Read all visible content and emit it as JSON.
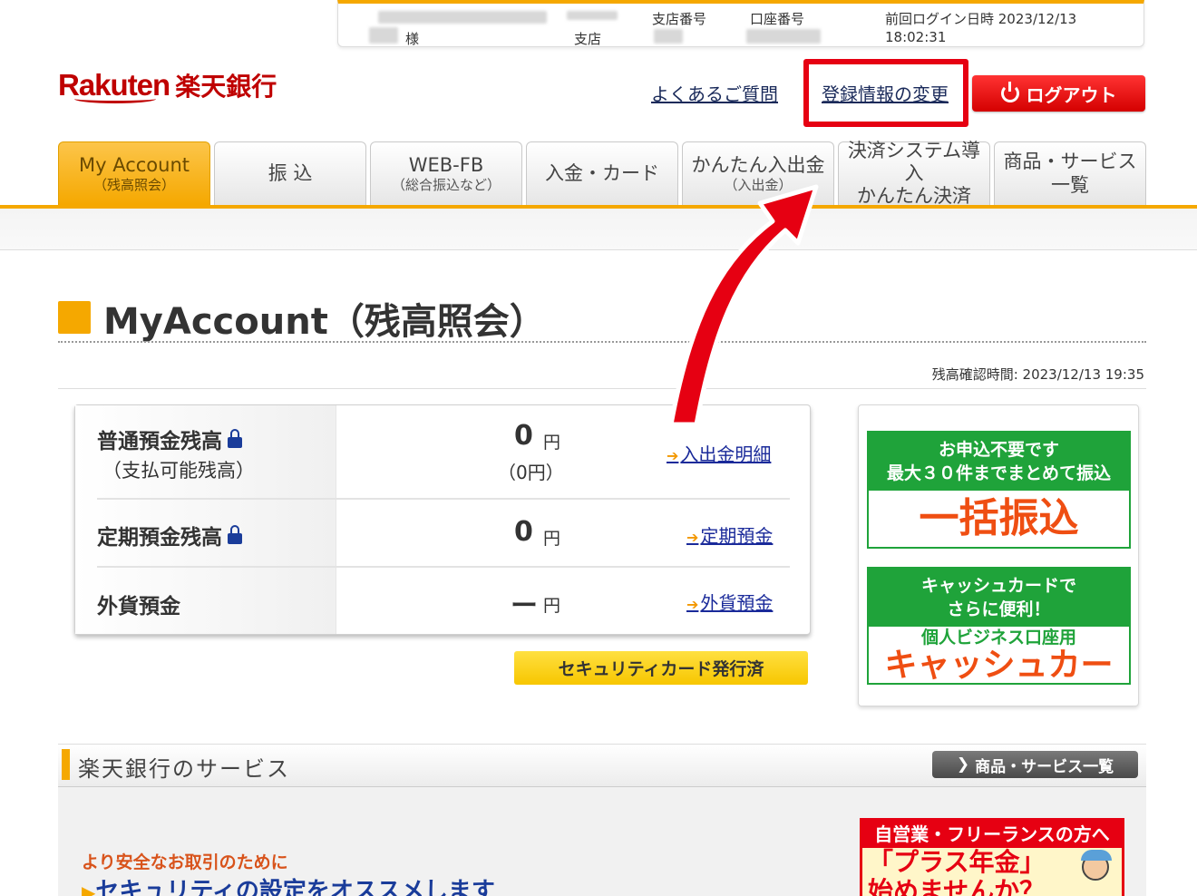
{
  "infobar": {
    "honorific": "様",
    "branch_suffix": "支店",
    "branch_no_label": "支店番号",
    "account_no_label": "口座番号",
    "last_login_label": "前回ログイン日時 2023/12/13",
    "last_login_time": "18:02:31"
  },
  "header": {
    "logo_en": "Rakuten",
    "logo_jp": "楽天銀行",
    "faq_link": "よくあるご質問",
    "profile_link": "登録情報の変更",
    "logout_label": "ログアウト"
  },
  "tabs": [
    {
      "label": "My Account",
      "sub": "（残高照会）"
    },
    {
      "label": "振 込",
      "sub": ""
    },
    {
      "label": "WEB-FB",
      "sub": "（総合振込など）"
    },
    {
      "label": "入金・カード",
      "sub": ""
    },
    {
      "label": "かんたん入出金",
      "sub": "（入出金）"
    },
    {
      "label": "決済システム導入",
      "sub": "かんたん決済"
    },
    {
      "label": "商品・サービス",
      "sub": "一覧"
    }
  ],
  "page": {
    "title": "MyAccount（残高照会）",
    "confirm_time": "残高確認時間: 2023/12/13 19:35"
  },
  "balances": {
    "ordinary": {
      "label": "普通預金残高",
      "sub": "（支払可能残高）",
      "amount": "0",
      "unit": "円",
      "amount_sub": "（0円）",
      "link": "入出金明細"
    },
    "time": {
      "label": "定期預金残高",
      "amount": "0",
      "unit": "円",
      "link": "定期預金"
    },
    "foreign": {
      "label": "外貨預金",
      "amount": "ー",
      "unit": "円",
      "link": "外貨預金"
    }
  },
  "security_card_button": "セキュリティカード発行済",
  "banners": {
    "bulk": {
      "line1": "お申込不要です",
      "line2": "最大３０件までまとめて振込",
      "big": "一括振込"
    },
    "cash": {
      "line1": "キャッシュカードで",
      "line2": "さらに便利！",
      "mid": "個人ビジネス口座用",
      "big": "キャッシュカード"
    }
  },
  "services": {
    "title": "楽天銀行のサービス",
    "list_button": "商品・サービス一覧",
    "safety_note": "より安全なお取引のために",
    "recommend": "セキュリティの設定をオススメします",
    "self_banner_head": "自営業・フリーランスの方へ",
    "self_banner_body": "「プラス年金」",
    "self_banner_body2": "始めませんか？"
  },
  "colors": {
    "accent": "#f5a800",
    "brand": "#bf0000",
    "highlight": "#e60012",
    "green": "#1fa33a"
  }
}
